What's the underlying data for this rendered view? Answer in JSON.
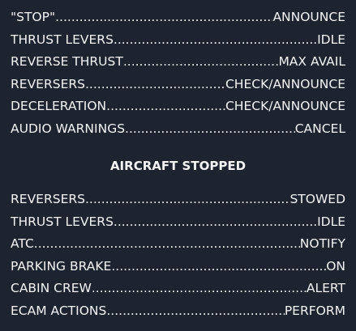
{
  "sections": [
    {
      "items": [
        {
          "item": "\"STOP\"",
          "action": "ANNOUNCE"
        },
        {
          "item": "THRUST LEVERS",
          "action": "IDLE"
        },
        {
          "item": "REVERSE THRUST",
          "action": "MAX AVAIL"
        },
        {
          "item": "REVERSERS",
          "action": "CHECK/ANNOUNCE"
        },
        {
          "item": "DECELERATION",
          "action": "CHECK/ANNOUNCE"
        },
        {
          "item": "AUDIO WARNINGS",
          "action": "CANCEL"
        }
      ]
    },
    {
      "heading": "AIRCRAFT STOPPED",
      "items": [
        {
          "item": "REVERSERS",
          "action": "STOWED"
        },
        {
          "item": "THRUST LEVERS",
          "action": "IDLE"
        },
        {
          "item": "ATC",
          "action": "NOTIFY"
        },
        {
          "item": "PARKING BRAKE",
          "action": "ON"
        },
        {
          "item": "CABIN CREW",
          "action": "ALERT"
        },
        {
          "item": "ECAM ACTIONS",
          "action": "PERFORM"
        }
      ]
    }
  ]
}
